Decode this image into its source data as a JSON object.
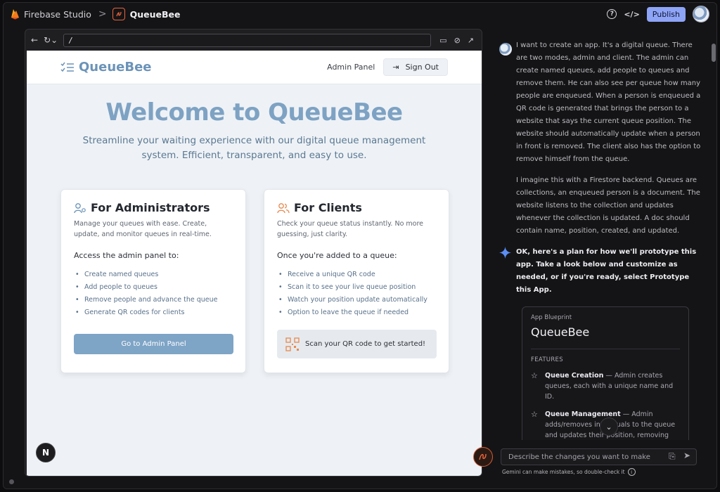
{
  "topbar": {
    "brand": "Firebase Studio",
    "separator": ">",
    "project": "QueueBee",
    "help_icon": "?",
    "code_icon": "</>",
    "publish_label": "Publish"
  },
  "browser": {
    "url": "/"
  },
  "site": {
    "logo_text": "QueueBee",
    "nav": {
      "admin_panel": "Admin Panel",
      "sign_out": "Sign Out"
    },
    "hero_title": "Welcome to QueueBee",
    "hero_subtitle": "Streamline your waiting experience with our digital queue management system. Efficient, transparent, and easy to use.",
    "admin_card": {
      "title": "For Administrators",
      "description": "Manage your queues with ease. Create, update, and monitor queues in real-time.",
      "lead": "Access the admin panel to:",
      "items": [
        "Create named queues",
        "Add people to queues",
        "Remove people and advance the queue",
        "Generate QR codes for clients"
      ],
      "button": "Go to Admin Panel"
    },
    "client_card": {
      "title": "For Clients",
      "description": "Check your queue status instantly. No more guessing, just clarity.",
      "lead": "Once you're added to a queue:",
      "items": [
        "Receive a unique QR code",
        "Scan it to see your live queue position",
        "Watch your position update automatically",
        "Option to leave the queue if needed"
      ],
      "scan_text": "Scan your QR code to get started!"
    },
    "badge": "N"
  },
  "chat": {
    "user_messages": [
      "I want to create an app. It's a digital queue. There are two modes, admin and client. The admin can create named queues, add people to queues and remove them. He can also see per queue how many people are enqueued. When a person is enqueued a QR code is generated that brings the person to a website that says the current queue position. The website should automatically update when a person in front is removed. The client also has the option to remove himself from the queue.",
      "I imagine this with a Firestore backend. Queues are collections, an enqueued person is a document. The website listens to the collection and updates whenever the collection is updated. A doc should contain name, position, created, and updated."
    ],
    "ai_message": "OK, here's a plan for how we'll prototype this app. Take a look below and customize as needed, or if you're ready, select Prototype this App.",
    "blueprint": {
      "label": "App Blueprint",
      "name": "QueueBee",
      "features_label": "FEATURES",
      "features": [
        {
          "name": "Queue Creation",
          "text": " — Admin creates queues, each with a unique name and ID."
        },
        {
          "name": "Queue Management",
          "text": " — Admin adds/removes individuals to the queue and updates their position, removing advances the queue for all waiting."
        }
      ]
    },
    "input_placeholder": "Describe the changes you want to make",
    "disclaimer": "Gemini can make mistakes, so double-check it"
  }
}
